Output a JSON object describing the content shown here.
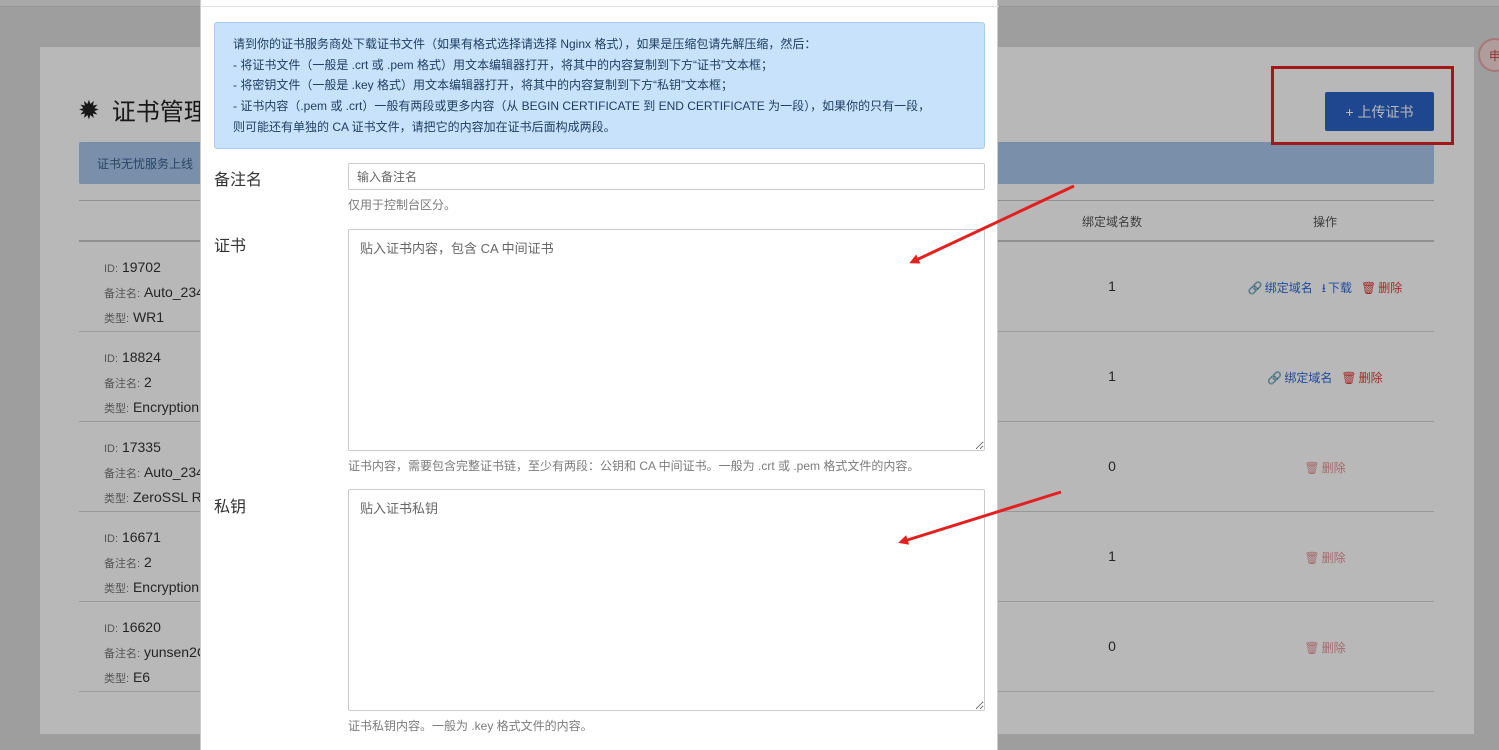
{
  "page": {
    "title": "证书管理",
    "upload_label": "+ 上传证书",
    "info_text": "证书无忧服务上线",
    "columns": {
      "bound": "绑定域名数",
      "ops": "操作"
    },
    "side_badge": "申"
  },
  "labels": {
    "id": "ID:",
    "note": "备注名:",
    "type": "类型:"
  },
  "rows": [
    {
      "id": "19702",
      "note": "Auto_234",
      "type": "WR1",
      "count": "1",
      "actions": [
        "bind",
        "download",
        "delete"
      ],
      "faded": false
    },
    {
      "id": "18824",
      "note": "2",
      "type": "Encryption",
      "count": "1",
      "actions": [
        "bind",
        "delete"
      ],
      "faded": false
    },
    {
      "id": "17335",
      "note": "Auto_234",
      "type": "ZeroSSL R",
      "count": "0",
      "actions": [
        "delete"
      ],
      "faded": true
    },
    {
      "id": "16671",
      "note": "2",
      "type": "Encryption",
      "count": "1",
      "actions": [
        "delete"
      ],
      "faded": true
    },
    {
      "id": "16620",
      "note": "yunsen2C",
      "type": "E6",
      "count": "0",
      "actions": [
        "delete"
      ],
      "faded": true
    }
  ],
  "actions_text": {
    "bind": "绑定域名",
    "download": "下载",
    "delete": "删除"
  },
  "modal": {
    "notice": [
      "请到你的证书服务商处下载证书文件（如果有格式选择请选择 Nginx 格式），如果是压缩包请先解压缩，然后：",
      "- 将证书文件（一般是 .crt 或 .pem 格式）用文本编辑器打开，将其中的内容复制到下方“证书”文本框；",
      "- 将密钥文件（一般是 .key 格式）用文本编辑器打开，将其中的内容复制到下方“私钥”文本框；",
      "- 证书内容（.pem 或 .crt）一般有两段或更多内容（从 BEGIN CERTIFICATE 到 END CERTIFICATE 为一段），如果你的只有一段，",
      "则可能还有单独的 CA 证书文件，请把它的内容加在证书后面构成两段。"
    ],
    "note_label": "备注名",
    "note_placeholder": "输入备注名",
    "note_help": "仅用于控制台区分。",
    "cert_label": "证书",
    "cert_placeholder": "贴入证书内容，包含 CA 中间证书",
    "cert_help": "证书内容，需要包含完整证书链，至少有两段：公钥和 CA 中间证书。一般为 .crt 或 .pem 格式文件的内容。",
    "key_label": "私钥",
    "key_placeholder": "贴入证书私钥",
    "key_help": "证书私钥内容。一般为 .key 格式文件的内容。"
  },
  "colors": {
    "accent": "#2c63c7",
    "annotation": "#e32020",
    "notice_bg": "#c9e2fb",
    "delete": "#e03b3b",
    "link": "#2f6ad8"
  }
}
